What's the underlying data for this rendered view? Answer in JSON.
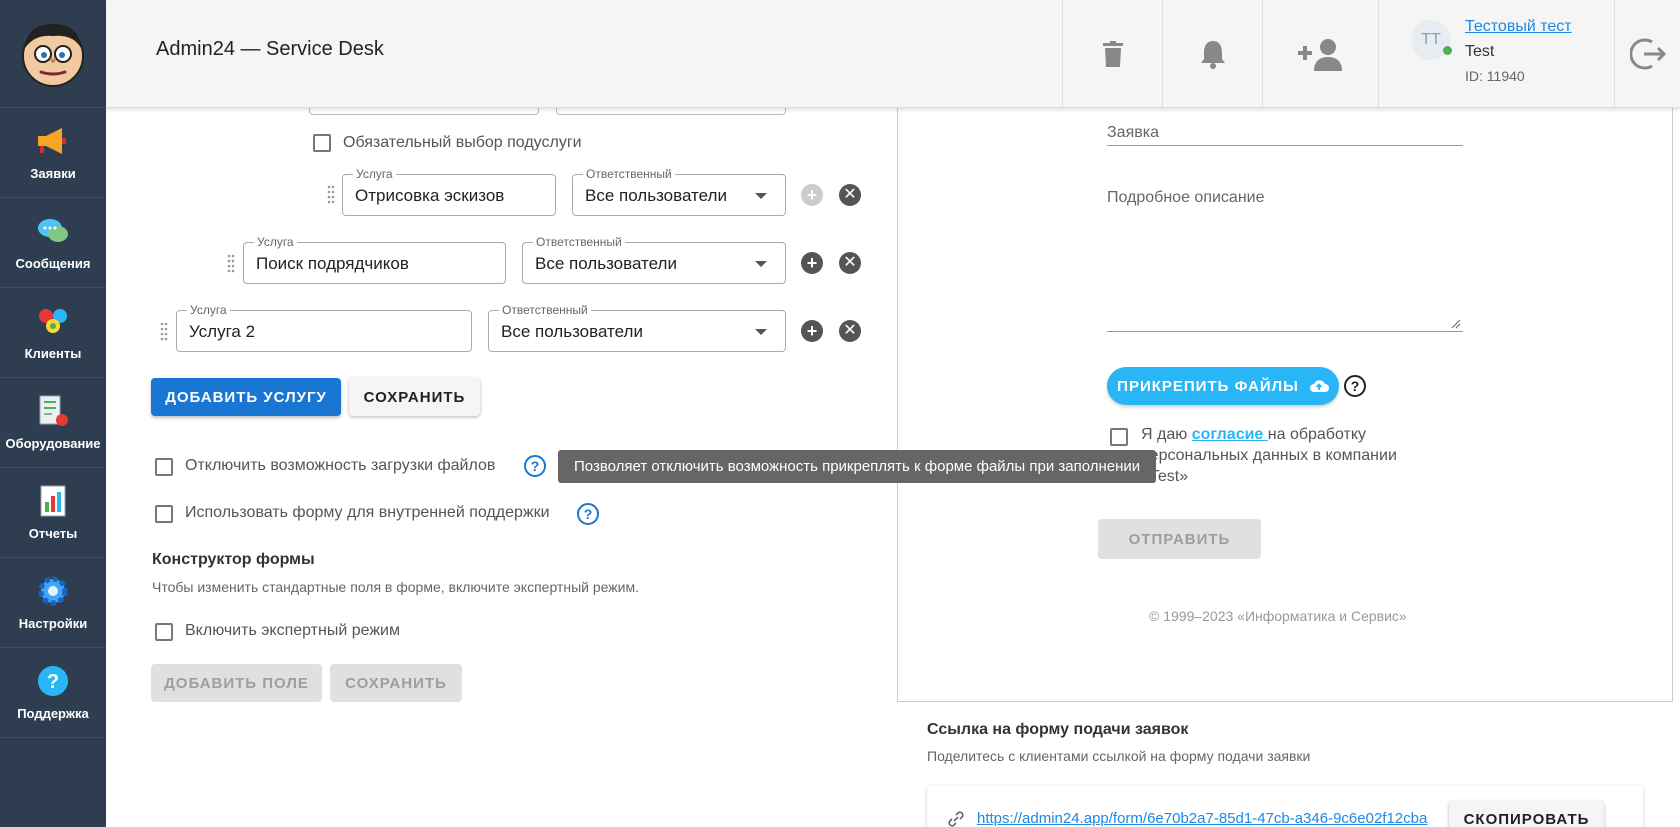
{
  "app": {
    "title": "Admin24 — Service Desk"
  },
  "sidebar": {
    "items": [
      {
        "label": "Заявки",
        "icon": "megaphone-icon"
      },
      {
        "label": "Сообщения",
        "icon": "chat-bubbles-icon"
      },
      {
        "label": "Клиенты",
        "icon": "people-icon"
      },
      {
        "label": "Оборудование",
        "icon": "equipment-icon"
      },
      {
        "label": "Отчеты",
        "icon": "report-chart-icon"
      },
      {
        "label": "Настройки",
        "icon": "gear-icon"
      },
      {
        "label": "Поддержка",
        "icon": "help-icon"
      }
    ]
  },
  "header": {
    "user": {
      "initials": "TT",
      "name": "Тестовый тест",
      "company": "Test",
      "id_text": "ID: 11940"
    }
  },
  "services": {
    "mandatory_sub_label": "Обязательный выбор подуслуги",
    "rows": [
      {
        "service_label": "Услуга",
        "service_value": "Отрисовка эскизов",
        "resp_label": "Ответственный",
        "resp_value": "Все пользователи"
      },
      {
        "service_label": "Услуга",
        "service_value": "Поиск подрядчиков",
        "resp_label": "Ответственный",
        "resp_value": "Все пользователи"
      },
      {
        "service_label": "Услуга",
        "service_value": "Услуга 2",
        "resp_label": "Ответственный",
        "resp_value": "Все пользователи"
      }
    ],
    "add_button": "ДОБАВИТЬ УСЛУГУ",
    "save_button": "СОХРАНИТЬ"
  },
  "options": {
    "disable_upload": "Отключить возможность загрузки файлов",
    "internal_support": "Использовать форму для внутренней поддержки",
    "tooltip": "Позволяет отключить возможность прикреплять к форме файлы при заполнении"
  },
  "constructor": {
    "title": "Конструктор формы",
    "subtitle": "Чтобы изменить стандартные поля в форме, включите экспертный режим.",
    "expert_mode": "Включить экспертный режим",
    "add_field_button": "ДОБАВИТЬ ПОЛЕ",
    "save_button": "СОХРАНИТЬ"
  },
  "preview": {
    "field_request": "Заявка",
    "field_description": "Подробное описание",
    "attach_button": "ПРИКРЕПИТЬ ФАЙЛЫ",
    "consent_prefix": "Я даю ",
    "consent_link": "согласие ",
    "consent_suffix": "на обработку персональных данных в компании «Test»",
    "submit_button": "ОТПРАВИТЬ",
    "copyright": "© 1999–2023 «Информатика и Сервис»"
  },
  "share": {
    "title": "Ссылка на форму подачи заявок",
    "subtitle": "Поделитесь с клиентами ссылкой на форму подачи заявки",
    "url": "https://admin24.app/form/6e70b2a7-85d1-47cb-a346-9c6e02f12cba",
    "copy_button": "СКОПИРОВАТЬ"
  },
  "colors": {
    "sidebar_bg": "#2e3e50",
    "primary": "#1976d2",
    "accent": "#29b6f6",
    "online": "#4caf50"
  }
}
